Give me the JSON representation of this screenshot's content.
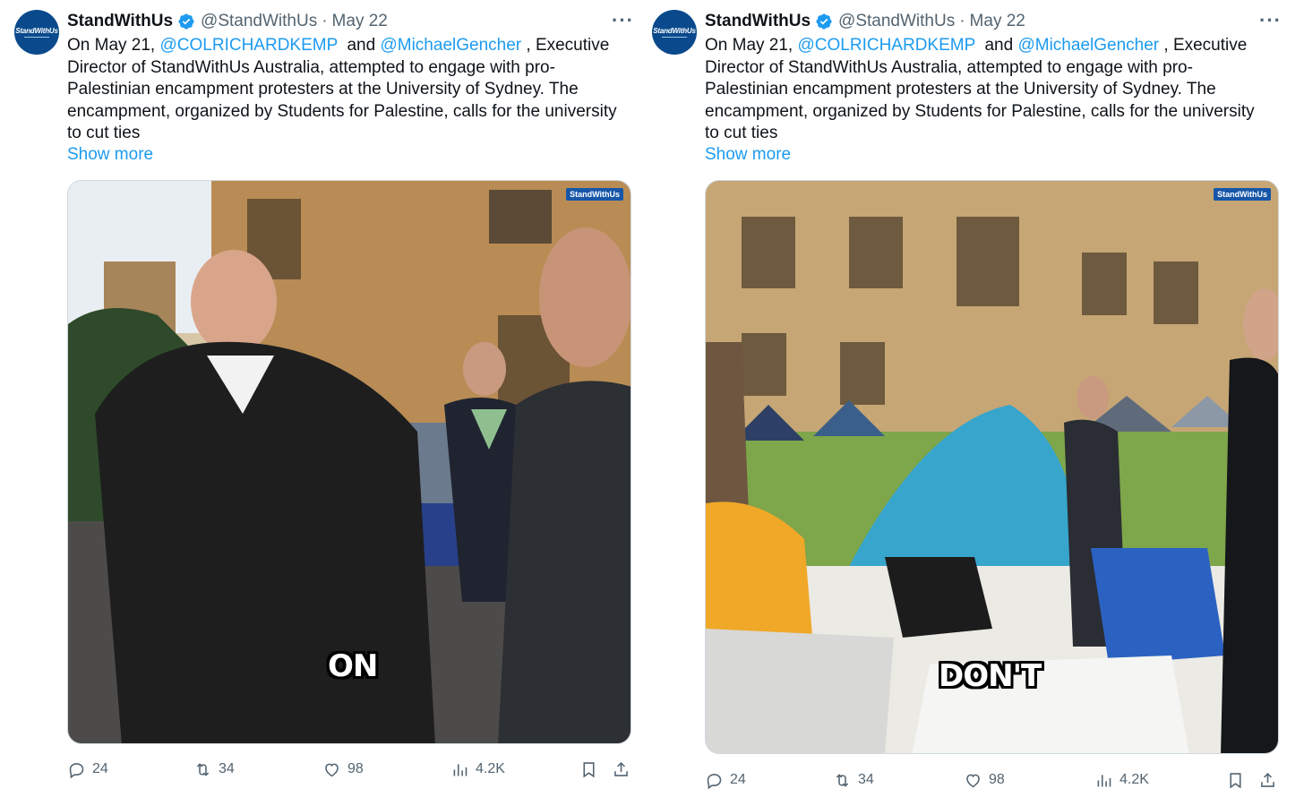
{
  "tweets": [
    {
      "avatar_text": "StandWithUs",
      "name": "StandWithUs",
      "handle": "@StandWithUs",
      "date": "May 22",
      "more": "···",
      "text_lines": {
        "l1_pre": "On May 21, ",
        "l1_m1": "@COLRICHARDKEMP",
        "l1_mid": "  and ",
        "l1_m2": "@MichaelGencher",
        "l1_post": " , Executive",
        "l2": "Director of StandWithUs Australia, attempted to engage with pro-",
        "l3": "Palestinian encampment protesters at the University of Sydney. The",
        "l4": "encampment, organized by Students for Palestine, calls for the university",
        "l5": "to cut ties"
      },
      "show_more": "Show more",
      "video_watermark": "StandWithUs",
      "video_caption": "ON",
      "replies": "24",
      "reposts": "34",
      "likes": "98",
      "views": "4.2K"
    },
    {
      "avatar_text": "StandWithUs",
      "name": "StandWithUs",
      "handle": "@StandWithUs",
      "date": "May 22",
      "more": "···",
      "text_lines": {
        "l1_pre": "On May 21, ",
        "l1_m1": "@COLRICHARDKEMP",
        "l1_mid": "  and ",
        "l1_m2": "@MichaelGencher",
        "l1_post": " , Executive",
        "l2": "Director of StandWithUs Australia, attempted to engage with pro-",
        "l3": "Palestinian encampment protesters at the University of Sydney. The",
        "l4": "encampment, organized by Students for Palestine, calls for the university",
        "l5": "to cut ties"
      },
      "show_more": "Show more",
      "video_watermark": "StandWithUs",
      "video_caption": "DON'T",
      "replies": "24",
      "reposts": "34",
      "likes": "98",
      "views": "4.2K"
    }
  ],
  "colors": {
    "link": "#1d9bf0",
    "secondary_text": "#536471",
    "verified": "#1d9bf0",
    "avatar_bg": "#0a4a8c"
  },
  "icons": [
    "verified-badge-icon",
    "more-icon",
    "reply-icon",
    "repost-icon",
    "like-icon",
    "views-icon",
    "bookmark-icon",
    "share-icon"
  ]
}
